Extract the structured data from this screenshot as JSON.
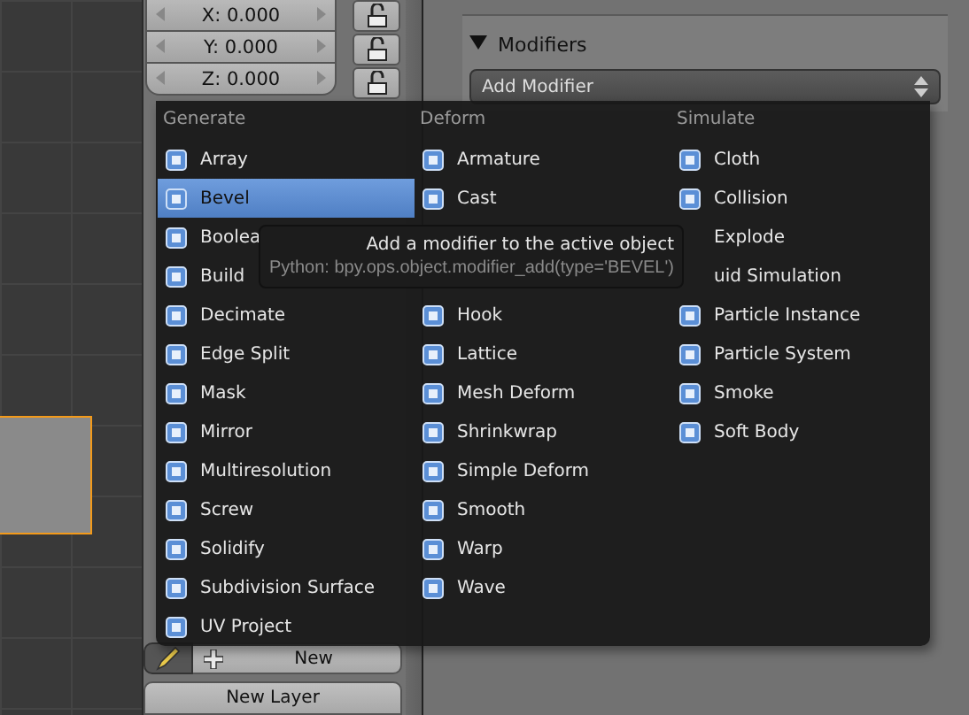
{
  "transform_fields": [
    {
      "label": "X: 0.000",
      "locked": false
    },
    {
      "label": "Y: 0.000",
      "locked": false
    },
    {
      "label": "Z: 0.000",
      "locked": false
    }
  ],
  "modifiers_panel": {
    "title": "Modifiers",
    "expanded": true,
    "add_button": "Add Modifier"
  },
  "menu": {
    "columns": [
      {
        "heading": "Generate",
        "items": [
          {
            "kind": "entry",
            "label": "Array",
            "selected": false
          },
          {
            "kind": "entry",
            "label": "Bevel",
            "selected": true
          },
          {
            "kind": "entry",
            "label": "Boolea",
            "selected": false
          },
          {
            "kind": "entry",
            "label": "Build",
            "selected": false
          },
          {
            "kind": "entry",
            "label": "Decimate",
            "selected": false
          },
          {
            "kind": "entry",
            "label": "Edge Split",
            "selected": false
          },
          {
            "kind": "entry",
            "label": "Mask",
            "selected": false
          },
          {
            "kind": "entry",
            "label": "Mirror",
            "selected": false
          },
          {
            "kind": "entry",
            "label": "Multiresolution",
            "selected": false
          },
          {
            "kind": "entry",
            "label": "Screw",
            "selected": false
          },
          {
            "kind": "entry",
            "label": "Solidify",
            "selected": false
          },
          {
            "kind": "entry",
            "label": "Subdivision Surface",
            "selected": false
          },
          {
            "kind": "entry",
            "label": "UV Project",
            "selected": false
          }
        ]
      },
      {
        "heading": "Deform",
        "items": [
          {
            "kind": "entry",
            "label": "Armature",
            "selected": false
          },
          {
            "kind": "entry",
            "label": "Cast",
            "selected": false
          },
          {
            "kind": "covered"
          },
          {
            "kind": "covered"
          },
          {
            "kind": "entry",
            "label": "Hook",
            "selected": false
          },
          {
            "kind": "entry",
            "label": "Lattice",
            "selected": false
          },
          {
            "kind": "entry",
            "label": "Mesh Deform",
            "selected": false
          },
          {
            "kind": "entry",
            "label": "Shrinkwrap",
            "selected": false
          },
          {
            "kind": "entry",
            "label": "Simple Deform",
            "selected": false
          },
          {
            "kind": "entry",
            "label": "Smooth",
            "selected": false
          },
          {
            "kind": "entry",
            "label": "Warp",
            "selected": false
          },
          {
            "kind": "entry",
            "label": "Wave",
            "selected": false
          }
        ]
      },
      {
        "heading": "Simulate",
        "items": [
          {
            "kind": "entry",
            "label": "Cloth",
            "selected": false
          },
          {
            "kind": "entry",
            "label": "Collision",
            "selected": false
          },
          {
            "kind": "label_only",
            "label": "Explode",
            "selected": false
          },
          {
            "kind": "label_only",
            "label": "uid Simulation",
            "selected": false
          },
          {
            "kind": "entry",
            "label": "Particle Instance",
            "selected": false
          },
          {
            "kind": "entry",
            "label": "Particle System",
            "selected": false
          },
          {
            "kind": "entry",
            "label": "Smoke",
            "selected": false
          },
          {
            "kind": "entry",
            "label": "Soft Body",
            "selected": false
          }
        ]
      }
    ]
  },
  "tooltip": {
    "text": "Add a modifier to the active object",
    "python": "Python: bpy.ops.object.modifier_add(type='BEVEL')"
  },
  "grease_pencil": {
    "pencil_on": true,
    "new_button": "New",
    "new_layer_button": "New Layer"
  }
}
